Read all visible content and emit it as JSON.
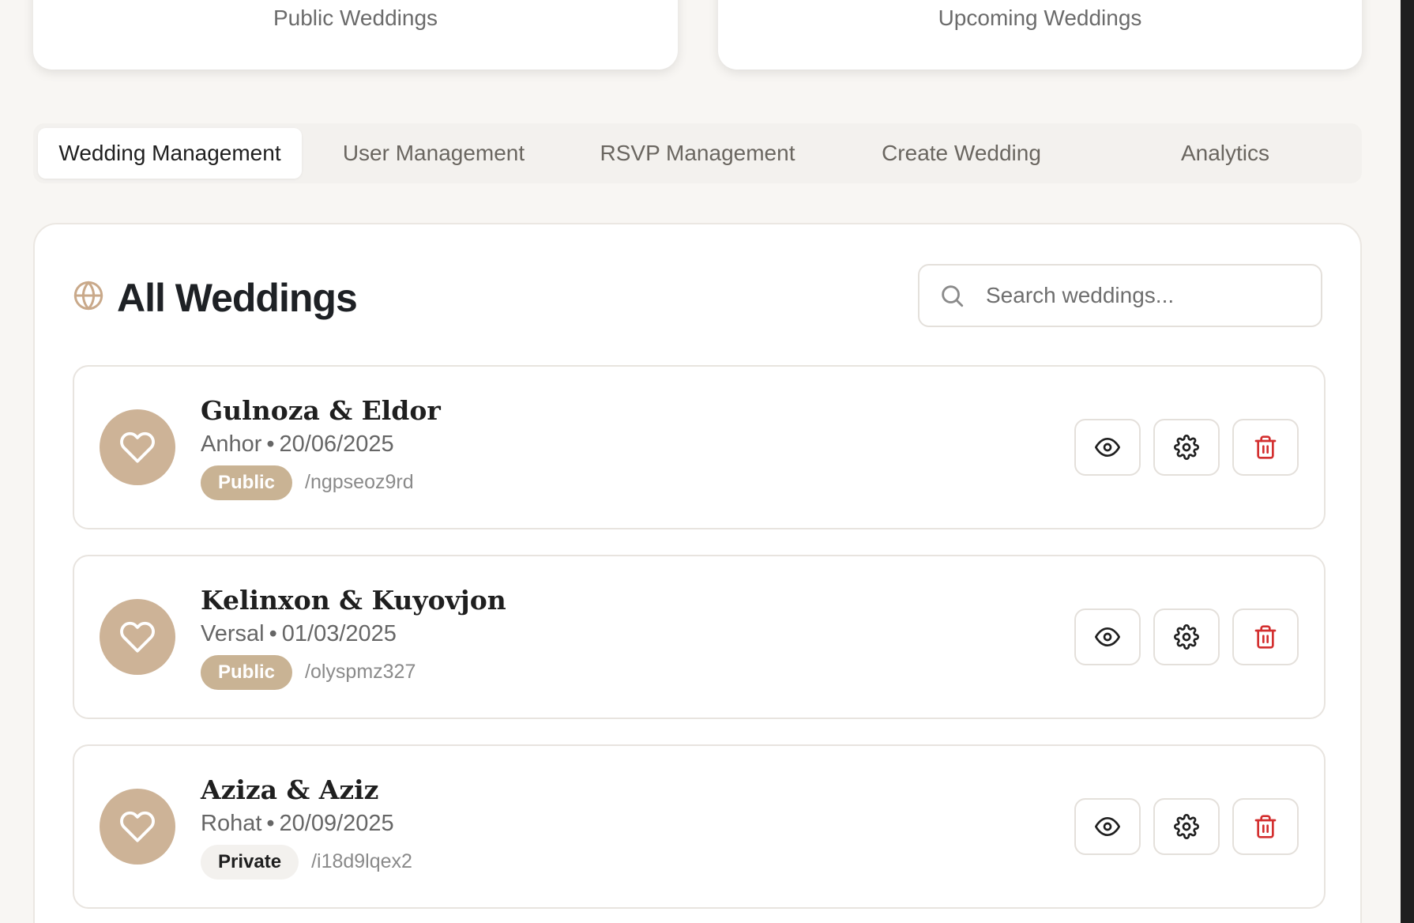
{
  "stats": {
    "public_label": "Public Weddings",
    "upcoming_label": "Upcoming Weddings"
  },
  "tabs": [
    {
      "label": "Wedding Management",
      "active": true
    },
    {
      "label": "User Management",
      "active": false
    },
    {
      "label": "RSVP Management",
      "active": false
    },
    {
      "label": "Create Wedding",
      "active": false
    },
    {
      "label": "Analytics",
      "active": false
    }
  ],
  "panel": {
    "title": "All Weddings",
    "title_icon": "globe-icon",
    "search": {
      "placeholder": "Search weddings...",
      "value": ""
    }
  },
  "weddings": [
    {
      "name": "Gulnoza & Eldor",
      "venue": "Anhor",
      "date": "20/06/2025",
      "visibility": "Public",
      "slug": "/ngpseoz9rd"
    },
    {
      "name": "Kelinxon & Kuyovjon",
      "venue": "Versal",
      "date": "01/03/2025",
      "visibility": "Public",
      "slug": "/olyspmz327"
    },
    {
      "name": "Aziza & Aziz",
      "venue": "Rohat",
      "date": "20/09/2025",
      "visibility": "Private",
      "slug": "/i18d9lqex2"
    }
  ],
  "meta_separator": "•",
  "icons": {
    "avatar": "heart-icon",
    "view": "eye-icon",
    "settings": "gear-icon",
    "delete": "trash-icon"
  },
  "colors": {
    "accent": "#cdb397",
    "badge_public": "#c9b394",
    "delete_red": "#d32f2f",
    "background": "#f8f6f3"
  }
}
